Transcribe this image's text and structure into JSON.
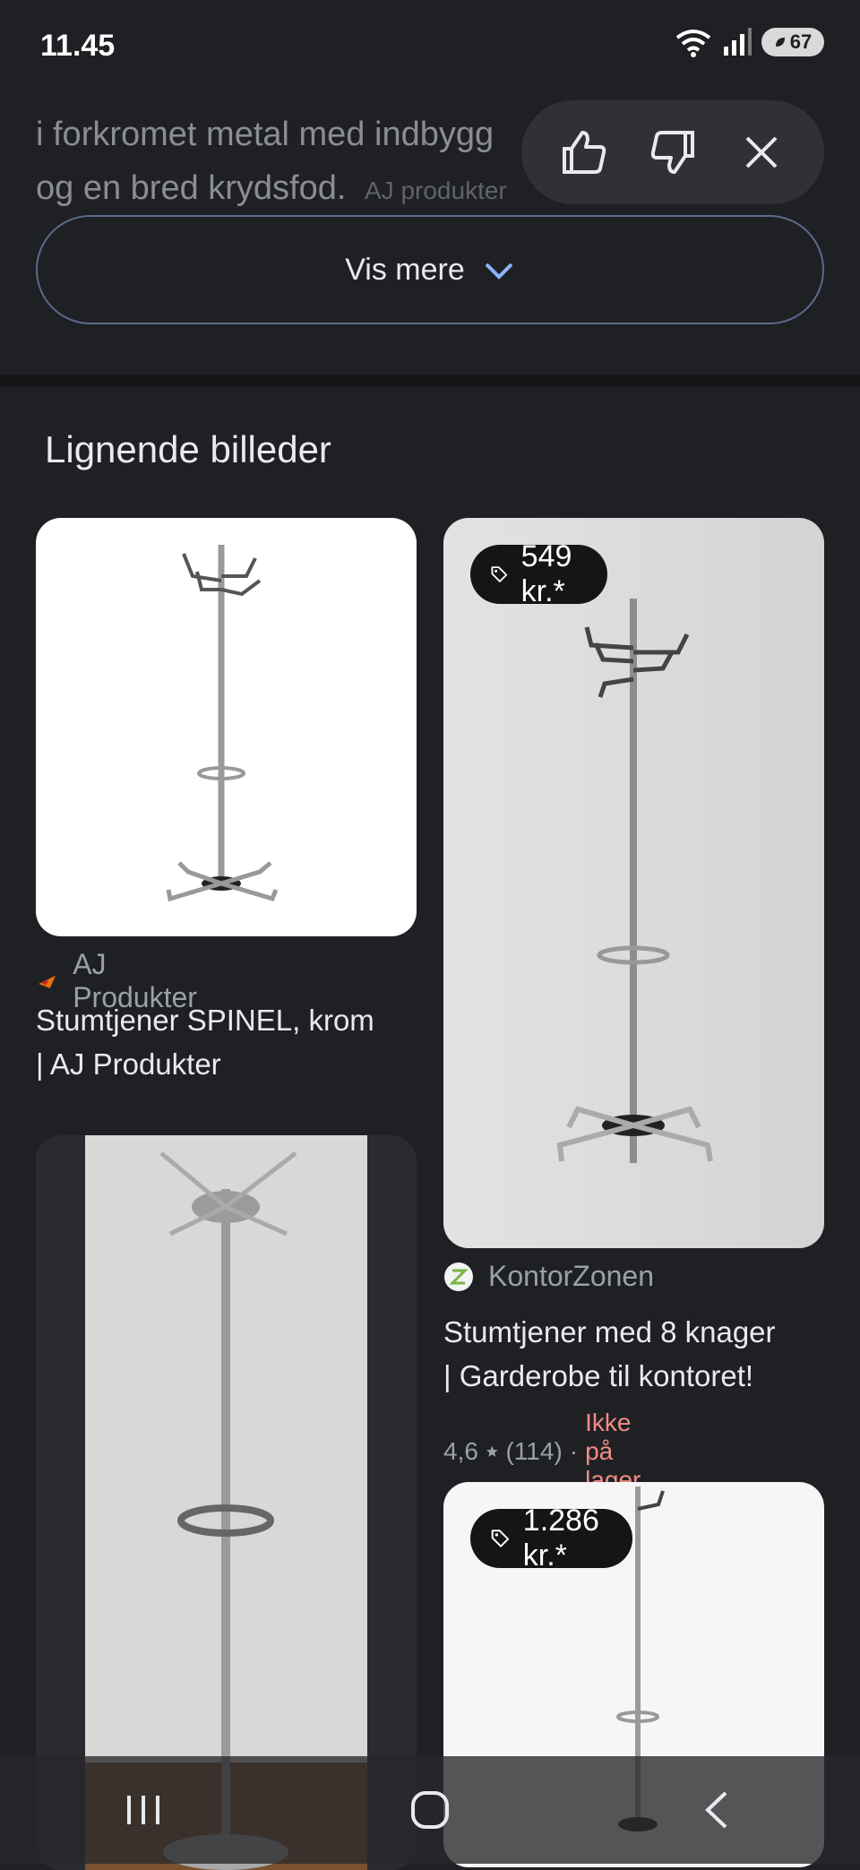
{
  "status_bar": {
    "time": "11.45",
    "battery": "67"
  },
  "snippet": {
    "line1": "i forkromet metal med indbygg",
    "line2": "og en bred krydsfod.",
    "source": "AJ produkter"
  },
  "feedback": {
    "like_icon": "thumbs-up-icon",
    "dislike_icon": "thumbs-down-icon",
    "close_icon": "close-icon"
  },
  "show_more": {
    "label": "Vis mere"
  },
  "section": {
    "title": "Lignende billeder"
  },
  "cards": [
    {
      "source": "AJ Produkter",
      "title_line1": "Stumtjener SPINEL, krom",
      "title_line2": "| AJ Produkter"
    },
    {
      "price": "549 kr.*",
      "source": "KontorZonen",
      "title_line1": "Stumtjener med 8 knager",
      "title_line2": "| Garderobe til kontoret!",
      "rating": "4,6",
      "reviews": "(114)",
      "separator": "·",
      "stock": "Ikke på lager"
    },
    {
      "price": "1.286 kr.*"
    },
    {}
  ],
  "nav": {
    "recents_icon": "recents-icon",
    "home_icon": "home-icon",
    "back_icon": "back-icon"
  }
}
